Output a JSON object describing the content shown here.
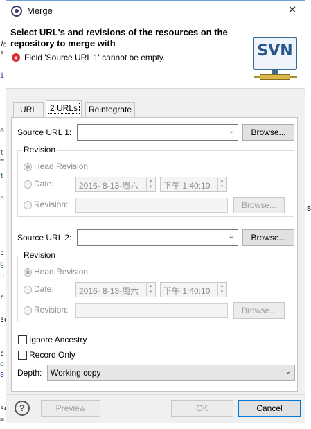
{
  "background": {
    "left_fragments": [
      "た",
      "!",
      "i",
      "a",
      "t",
      "=",
      "t",
      "h",
      "c",
      "g",
      "u",
      "c",
      "g",
      "u",
      "se",
      "=",
      "c",
      "g",
      "8",
      "se",
      "="
    ],
    "right_fragments": [
      "B"
    ]
  },
  "window": {
    "title": "Merge",
    "close_glyph": "✕"
  },
  "header": {
    "title": "Select URL's and revisions of the resources on the repository to merge with",
    "error_glyph": "x",
    "error_message": "Field 'Source URL 1' cannot be empty.",
    "logo_text": "SVN"
  },
  "tabs": [
    {
      "label": "URL",
      "active": false
    },
    {
      "label": "2 URLs",
      "active": true
    },
    {
      "label": "Reintegrate",
      "active": false
    }
  ],
  "source1": {
    "label": "Source URL 1:",
    "value": "",
    "browse_label": "Browse...",
    "revision_group_title": "Revision",
    "head_label": "Head Revision",
    "date_label": "Date:",
    "date_value": "2016-  8-13-周六",
    "time_value": "下午   1:40:10",
    "revision_label": "Revision:",
    "revision_value": "",
    "revision_browse_label": "Browse..."
  },
  "source2": {
    "label": "Source URL 2:",
    "value": "",
    "browse_label": "Browse...",
    "revision_group_title": "Revision",
    "head_label": "Head Revision",
    "date_label": "Date:",
    "date_value": "2016-  8-13-周六",
    "time_value": "下午   1:40:10",
    "revision_label": "Revision:",
    "revision_value": "",
    "revision_browse_label": "Browse..."
  },
  "options": {
    "ignore_ancestry": {
      "label": "Ignore Ancestry",
      "checked": false
    },
    "record_only": {
      "label": "Record Only",
      "checked": false
    },
    "depth_label": "Depth:",
    "depth_value": "Working copy"
  },
  "footer": {
    "help_glyph": "?",
    "preview_label": "Preview",
    "ok_label": "OK",
    "cancel_label": "Cancel"
  }
}
